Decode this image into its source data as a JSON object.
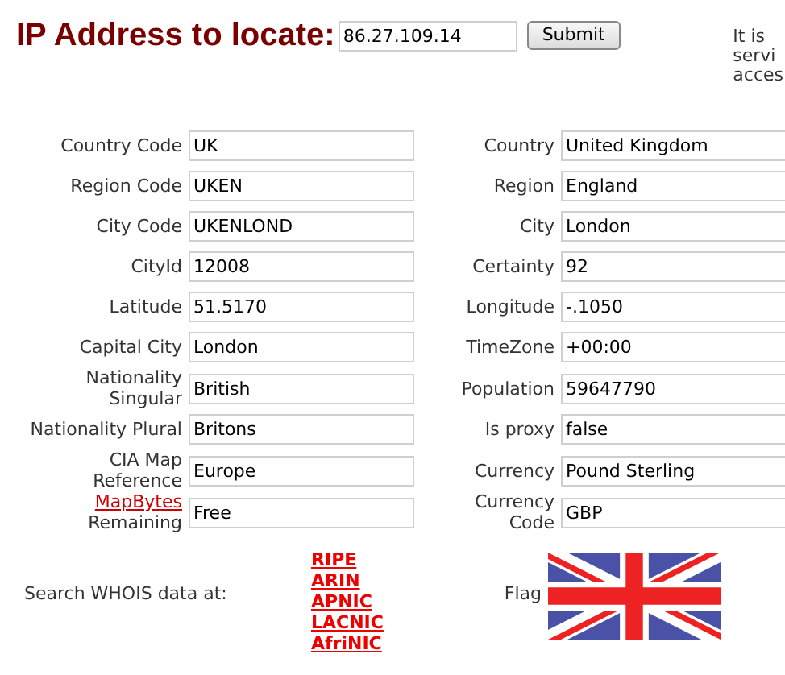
{
  "heading": "IP Address to locate:",
  "ip_field": {
    "value": "86.27.109.14"
  },
  "submit_button": "Submit",
  "side_note": [
    "It is",
    "servi",
    "acces"
  ],
  "rows": [
    {
      "left": {
        "label": [
          "Country Code"
        ],
        "value": "UK"
      },
      "right": {
        "label": [
          "Country"
        ],
        "value": "United Kingdom"
      }
    },
    {
      "left": {
        "label": [
          "Region Code"
        ],
        "value": "UKEN"
      },
      "right": {
        "label": [
          "Region"
        ],
        "value": "England"
      }
    },
    {
      "left": {
        "label": [
          "City Code"
        ],
        "value": "UKENLOND"
      },
      "right": {
        "label": [
          "City"
        ],
        "value": "London"
      }
    },
    {
      "left": {
        "label": [
          "CityId"
        ],
        "value": "12008"
      },
      "right": {
        "label": [
          "Certainty"
        ],
        "value": "92"
      }
    },
    {
      "left": {
        "label": [
          "Latitude"
        ],
        "value": "51.5170"
      },
      "right": {
        "label": [
          "Longitude"
        ],
        "value": "-.1050"
      }
    },
    {
      "left": {
        "label": [
          "Capital City"
        ],
        "value": "London"
      },
      "right": {
        "label": [
          "TimeZone"
        ],
        "value": "+00:00"
      }
    },
    {
      "left": {
        "label": [
          "Nationality",
          "Singular"
        ],
        "value": "British"
      },
      "right": {
        "label": [
          "Population"
        ],
        "value": "59647790"
      }
    },
    {
      "left": {
        "label": [
          "Nationality Plural"
        ],
        "value": "Britons"
      },
      "right": {
        "label": [
          "Is proxy"
        ],
        "value": "false"
      }
    },
    {
      "left": {
        "label": [
          "CIA Map",
          "Reference"
        ],
        "value": "Europe"
      },
      "right": {
        "label": [
          "Currency"
        ],
        "value": "Pound Sterling"
      }
    },
    {
      "left": {
        "label_link": "MapBytes",
        "label": [
          "Remaining"
        ],
        "value": "Free"
      },
      "right": {
        "label": [
          "Currency",
          "Code"
        ],
        "value": "GBP"
      }
    }
  ],
  "whois": {
    "label": "Search WHOIS data at:",
    "links": [
      "RIPE",
      "ARIN",
      "APNIC",
      "LACNIC",
      "AfriNIC"
    ]
  },
  "flag_label": "Flag"
}
